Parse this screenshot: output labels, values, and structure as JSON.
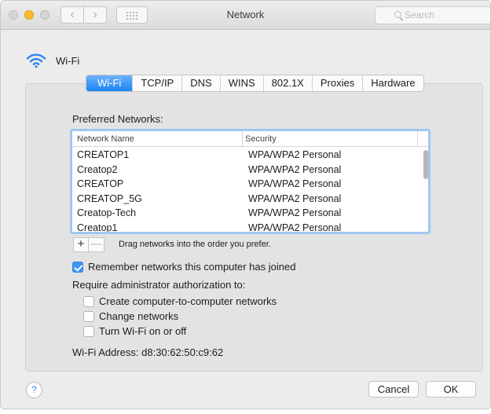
{
  "window": {
    "title": "Network"
  },
  "toolbar": {
    "search_placeholder": "Search"
  },
  "header": {
    "label": "Wi-Fi"
  },
  "tabs": [
    "Wi-Fi",
    "TCP/IP",
    "DNS",
    "WINS",
    "802.1X",
    "Proxies",
    "Hardware"
  ],
  "active_tab": "Wi-Fi",
  "preferred": {
    "label": "Preferred Networks:",
    "columns": [
      "Network Name",
      "Security"
    ],
    "rows": [
      {
        "name": "CREATOP1",
        "security": "WPA/WPA2 Personal"
      },
      {
        "name": "Creatop2",
        "security": "WPA/WPA2 Personal"
      },
      {
        "name": "CREATOP",
        "security": "WPA/WPA2 Personal"
      },
      {
        "name": "CREATOP_5G",
        "security": "WPA/WPA2 Personal"
      },
      {
        "name": "Creatop-Tech",
        "security": "WPA/WPA2 Personal"
      },
      {
        "name": "Creatop1",
        "security": "WPA/WPA2 Personal"
      }
    ],
    "add_label": "+",
    "remove_label": "—",
    "hint": "Drag networks into the order you prefer."
  },
  "remember": {
    "label": "Remember networks this computer has joined",
    "checked": true
  },
  "require_label": "Require administrator authorization to:",
  "options": [
    {
      "label": "Create computer-to-computer networks",
      "checked": false
    },
    {
      "label": "Change networks",
      "checked": false
    },
    {
      "label": "Turn Wi-Fi on or off",
      "checked": false
    }
  ],
  "address": "Wi-Fi Address:  d8:30:62:50:c9:62",
  "buttons": {
    "help": "?",
    "cancel": "Cancel",
    "ok": "OK"
  },
  "colors": {
    "accent": "#1c84f5",
    "traffic_minimize": "#fdbb2d",
    "list_focus_ring": "#9fc7f3"
  }
}
